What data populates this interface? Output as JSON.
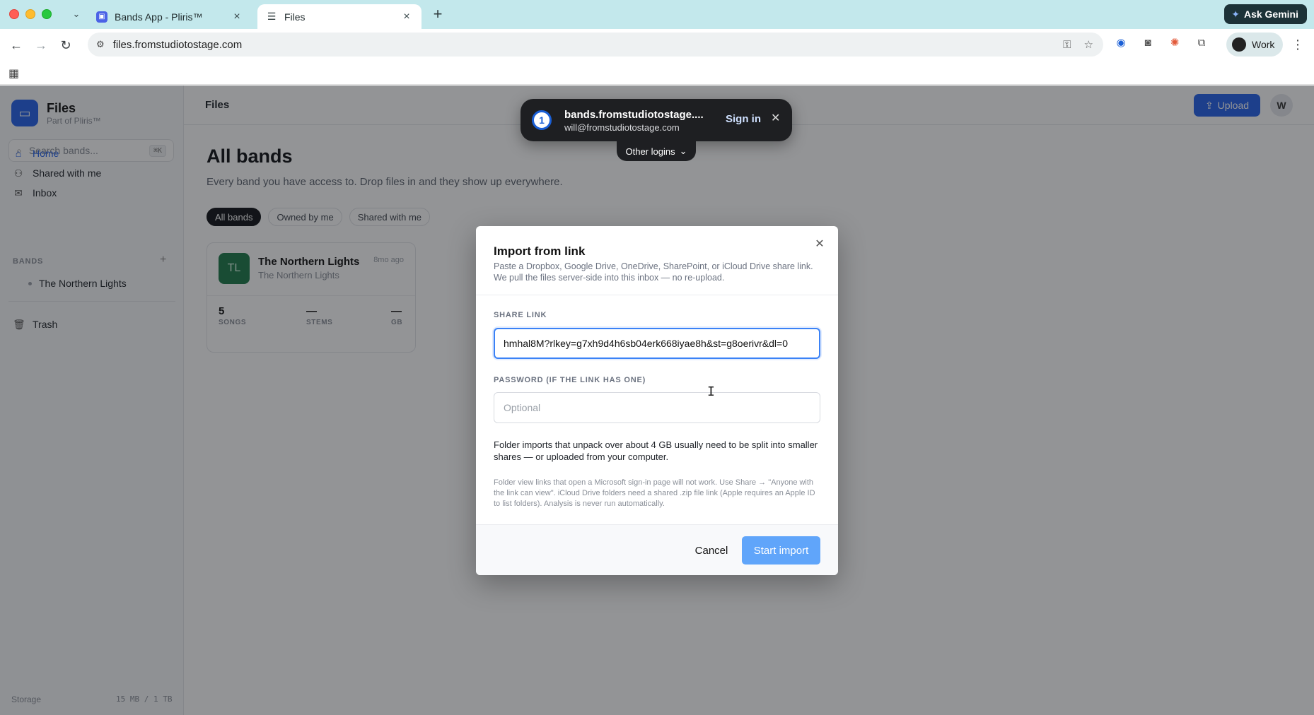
{
  "browser": {
    "tabs": [
      {
        "title": "Bands App - Pliris™",
        "favicon": "pliris-app-icon"
      },
      {
        "title": "Files",
        "favicon": "files-sliders-icon"
      }
    ],
    "ask_gemini": "Ask Gemini",
    "url": "files.fromstudiotostage.com",
    "profile": "Work"
  },
  "sidebar": {
    "brand_name": "Files",
    "brand_sub": "Part of Pliris™",
    "search_placeholder": "Search bands...",
    "search_shortcut": "⌘K",
    "nav": [
      {
        "label": "Home",
        "icon": "home-icon"
      },
      {
        "label": "Shared with me",
        "icon": "users-icon"
      },
      {
        "label": "Inbox",
        "icon": "inbox-icon"
      }
    ],
    "bands_label": "BANDS",
    "bands": [
      "The Northern Lights"
    ],
    "trash_label": "Trash",
    "storage_label": "Storage",
    "storage_value": "15 MB / 1 TB"
  },
  "header": {
    "crumb": "Files",
    "upload_label": "Upload",
    "user_initial": "W"
  },
  "main": {
    "title": "All bands",
    "subtitle": "Every band you have access to. Drop files in and they show up everywhere.",
    "filters": [
      "All bands",
      "Owned by me",
      "Shared with me"
    ],
    "card": {
      "initials": "TL",
      "name": "The Northern Lights",
      "sub": "The Northern Lights",
      "time": "8mo ago",
      "stats": [
        {
          "value": "5",
          "label": "SONGS"
        },
        {
          "value": "—",
          "label": "STEMS"
        },
        {
          "value": "—",
          "label": "GB"
        }
      ]
    }
  },
  "password_manager": {
    "site": "bands.fromstudiotostage....",
    "user": "will@fromstudiotostage.com",
    "sign_in": "Sign in",
    "other_logins": "Other logins"
  },
  "modal": {
    "title": "Import from link",
    "description": "Paste a Dropbox, Google Drive, OneDrive, SharePoint, or iCloud Drive share link. We pull the files server-side into this inbox — no re-upload.",
    "share_label": "SHARE LINK",
    "share_value": "hmhal8M?rlkey=g7xh9d4h6sb04erk668iyae8h&st=g8oerivr&dl=0",
    "password_label": "PASSWORD (IF THE LINK HAS ONE)",
    "password_placeholder": "Optional",
    "note_main": "Folder imports that unpack over about 4 GB usually need to be split into smaller shares — or uploaded from your computer.",
    "note_small": "Folder view links that open a Microsoft sign-in page will not work. Use Share → \"Anyone with the link can view\". iCloud Drive folders need a shared .zip file link (Apple requires an Apple ID to list folders). Analysis is never run automatically.",
    "cancel_label": "Cancel",
    "start_label": "Start import"
  },
  "colors": {
    "accent": "#2563eb",
    "start_button": "#60a5fa",
    "chrome_tabstrip": "#c3e8ec"
  }
}
